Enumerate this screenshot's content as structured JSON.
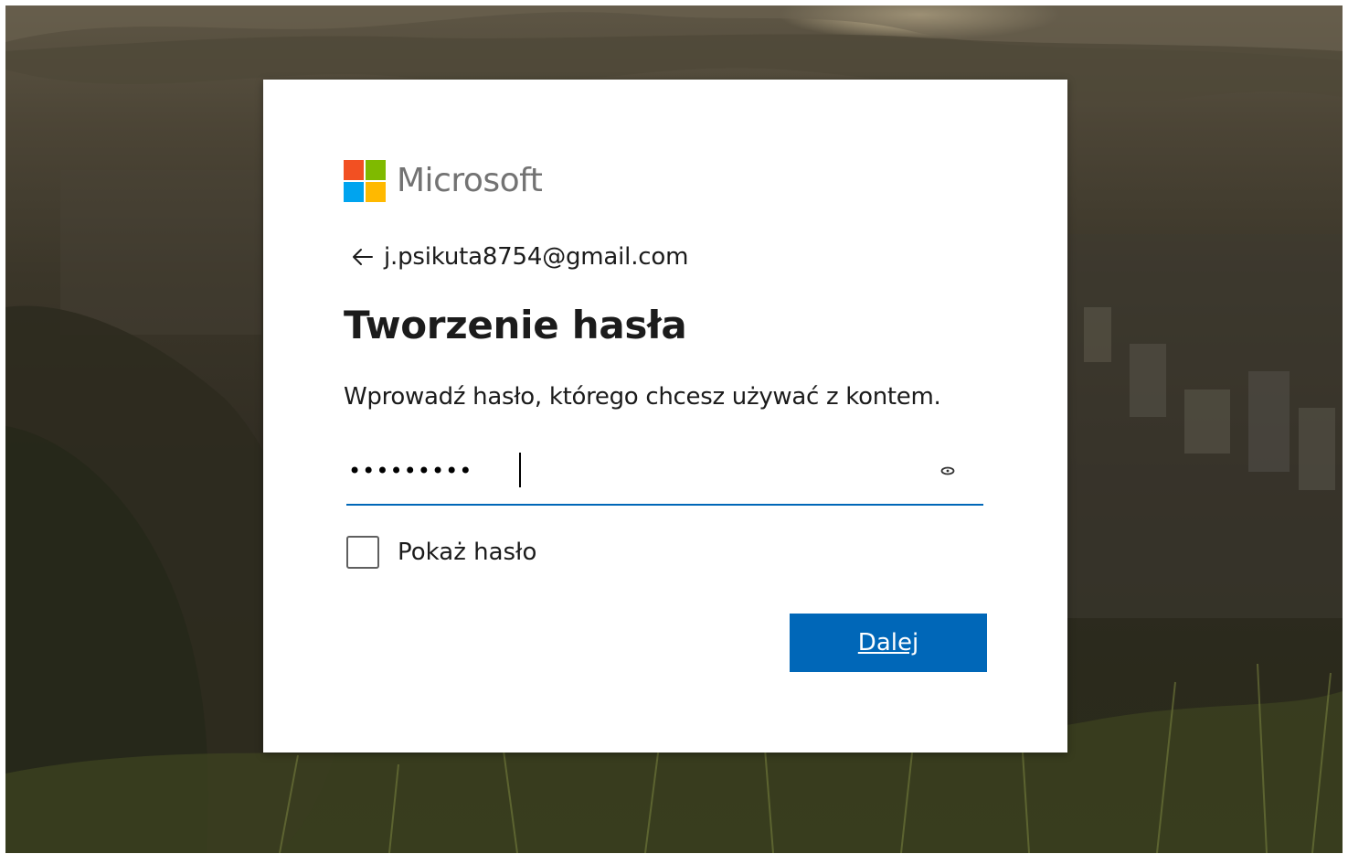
{
  "brand": {
    "name": "Microsoft",
    "logo_colors": [
      "#f25022",
      "#7fba00",
      "#00a4ef",
      "#ffb900"
    ]
  },
  "identity": {
    "email": "j.psikuta8754@gmail.com",
    "back_icon": "arrow-left-icon"
  },
  "title": "Tworzenie hasła",
  "description": "Wprowadź hasło, którego chcesz używać z kontem.",
  "password_field": {
    "value": "•••••••••",
    "reveal_icon": "eye-icon"
  },
  "show_password": {
    "label": "Pokaż hasło",
    "checked": false
  },
  "next_button": {
    "label": "Dalej"
  },
  "colors": {
    "accent": "#0067b8",
    "text": "#1b1b1b",
    "brand_text": "#737373"
  }
}
